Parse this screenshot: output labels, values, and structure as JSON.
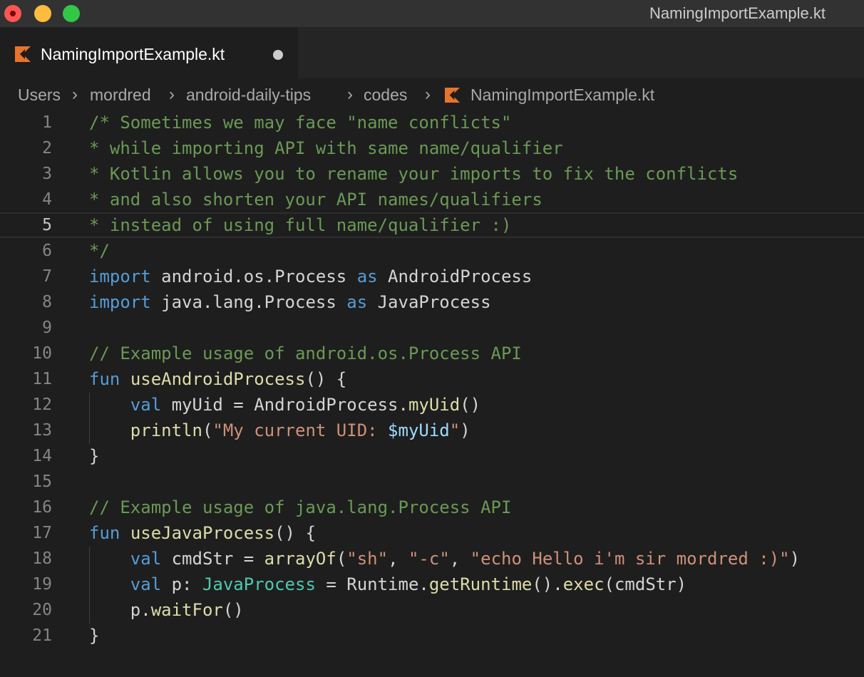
{
  "window": {
    "title": "NamingImportExample.kt"
  },
  "tab": {
    "label": "NamingImportExample.kt",
    "icon": "kotlin-file-icon",
    "unsaved": true
  },
  "breadcrumb": {
    "items": [
      "Users",
      "mordred",
      "android-daily-tips",
      "codes",
      "NamingImportExample.kt"
    ]
  },
  "colors": {
    "comment": "#6a9955",
    "keyword": "#569cd6",
    "function": "#dcdcaa",
    "string": "#ce9178",
    "variable": "#9cdcfe",
    "type": "#4ec9b0",
    "kotlin_icon": "#e8742b"
  },
  "editor": {
    "current_line": 5,
    "lines": [
      {
        "num": "1",
        "tokens": [
          {
            "t": "/* Sometimes we may face \"name conflicts\"",
            "c": "c"
          }
        ]
      },
      {
        "num": "2",
        "tokens": [
          {
            "t": "* while importing API with same name/qualifier",
            "c": "c"
          }
        ]
      },
      {
        "num": "3",
        "tokens": [
          {
            "t": "* Kotlin allows you to rename your imports to fix the conflicts",
            "c": "c"
          }
        ]
      },
      {
        "num": "4",
        "tokens": [
          {
            "t": "* and also shorten your API names/qualifiers",
            "c": "c"
          }
        ]
      },
      {
        "num": "5",
        "tokens": [
          {
            "t": "* instead of using full name/qualifier :)",
            "c": "c"
          }
        ]
      },
      {
        "num": "6",
        "tokens": [
          {
            "t": "*/",
            "c": "c"
          }
        ]
      },
      {
        "num": "7",
        "tokens": [
          {
            "t": "import",
            "c": "k"
          },
          {
            "t": " android.os.Process ",
            "c": "p"
          },
          {
            "t": "as",
            "c": "k"
          },
          {
            "t": " AndroidProcess",
            "c": "p"
          }
        ]
      },
      {
        "num": "8",
        "tokens": [
          {
            "t": "import",
            "c": "k"
          },
          {
            "t": " java.lang.Process ",
            "c": "p"
          },
          {
            "t": "as",
            "c": "k"
          },
          {
            "t": " JavaProcess",
            "c": "p"
          }
        ]
      },
      {
        "num": "9",
        "tokens": []
      },
      {
        "num": "10",
        "tokens": [
          {
            "t": "// Example usage of android.os.Process API",
            "c": "c"
          }
        ]
      },
      {
        "num": "11",
        "tokens": [
          {
            "t": "fun",
            "c": "k"
          },
          {
            "t": " ",
            "c": "p"
          },
          {
            "t": "useAndroidProcess",
            "c": "f"
          },
          {
            "t": "() {",
            "c": "p"
          }
        ]
      },
      {
        "num": "12",
        "tokens": [
          {
            "t": "    ",
            "c": "p"
          },
          {
            "t": "val",
            "c": "k"
          },
          {
            "t": " myUid = AndroidProcess.",
            "c": "p"
          },
          {
            "t": "myUid",
            "c": "f"
          },
          {
            "t": "()",
            "c": "p"
          }
        ]
      },
      {
        "num": "13",
        "tokens": [
          {
            "t": "    ",
            "c": "p"
          },
          {
            "t": "println",
            "c": "f"
          },
          {
            "t": "(",
            "c": "p"
          },
          {
            "t": "\"My current UID: ",
            "c": "s"
          },
          {
            "t": "$myUid",
            "c": "v"
          },
          {
            "t": "\"",
            "c": "s"
          },
          {
            "t": ")",
            "c": "p"
          }
        ]
      },
      {
        "num": "14",
        "tokens": [
          {
            "t": "}",
            "c": "p"
          }
        ]
      },
      {
        "num": "15",
        "tokens": []
      },
      {
        "num": "16",
        "tokens": [
          {
            "t": "// Example usage of java.lang.Process API",
            "c": "c"
          }
        ]
      },
      {
        "num": "17",
        "tokens": [
          {
            "t": "fun",
            "c": "k"
          },
          {
            "t": " ",
            "c": "p"
          },
          {
            "t": "useJavaProcess",
            "c": "f"
          },
          {
            "t": "() {",
            "c": "p"
          }
        ]
      },
      {
        "num": "18",
        "tokens": [
          {
            "t": "    ",
            "c": "p"
          },
          {
            "t": "val",
            "c": "k"
          },
          {
            "t": " cmdStr = ",
            "c": "p"
          },
          {
            "t": "arrayOf",
            "c": "f"
          },
          {
            "t": "(",
            "c": "p"
          },
          {
            "t": "\"sh\"",
            "c": "s"
          },
          {
            "t": ", ",
            "c": "p"
          },
          {
            "t": "\"-c\"",
            "c": "s"
          },
          {
            "t": ", ",
            "c": "p"
          },
          {
            "t": "\"echo Hello i'm sir mordred :)\"",
            "c": "s"
          },
          {
            "t": ")",
            "c": "p"
          }
        ]
      },
      {
        "num": "19",
        "tokens": [
          {
            "t": "    ",
            "c": "p"
          },
          {
            "t": "val",
            "c": "k"
          },
          {
            "t": " p: ",
            "c": "p"
          },
          {
            "t": "JavaProcess",
            "c": "t"
          },
          {
            "t": " = Runtime.",
            "c": "p"
          },
          {
            "t": "getRuntime",
            "c": "f"
          },
          {
            "t": "().",
            "c": "p"
          },
          {
            "t": "exec",
            "c": "f"
          },
          {
            "t": "(cmdStr)",
            "c": "p"
          }
        ]
      },
      {
        "num": "20",
        "tokens": [
          {
            "t": "    p.",
            "c": "p"
          },
          {
            "t": "waitFor",
            "c": "f"
          },
          {
            "t": "()",
            "c": "p"
          }
        ]
      },
      {
        "num": "21",
        "tokens": [
          {
            "t": "}",
            "c": "p"
          }
        ]
      }
    ]
  }
}
